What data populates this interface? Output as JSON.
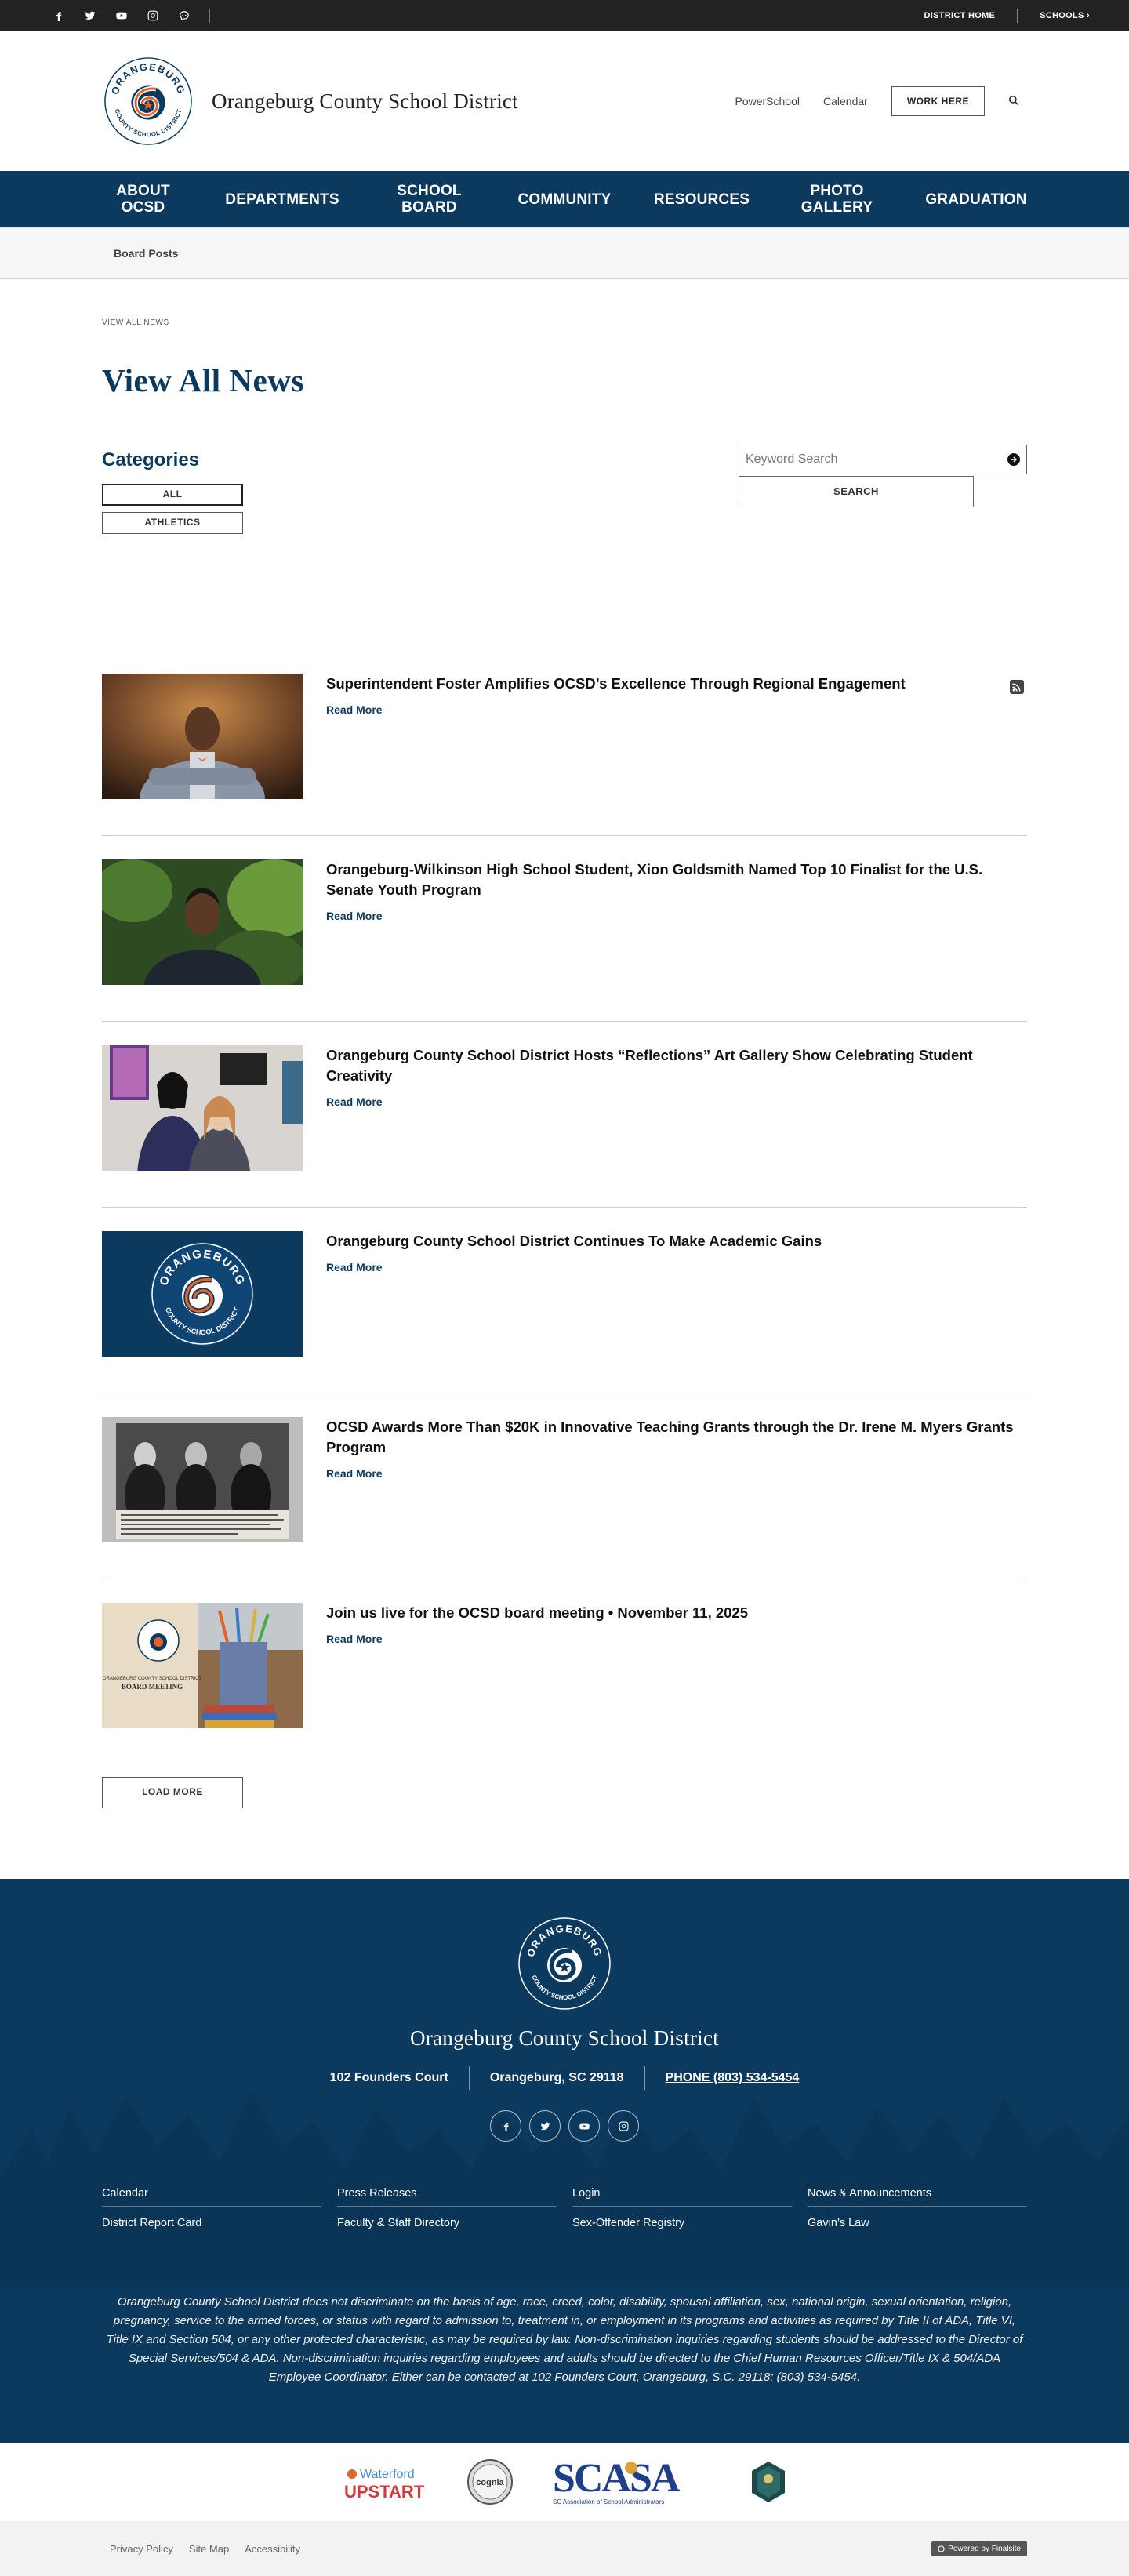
{
  "topbar": {
    "social": [
      "facebook-icon",
      "twitter-icon",
      "youtube-icon",
      "instagram-icon",
      "peachjar-icon"
    ],
    "district_home": "DISTRICT HOME",
    "schools": "SCHOOLS ›"
  },
  "header": {
    "site_name": "Orangeburg County School District",
    "logo_top_text": "ORANGEBURG",
    "logo_bottom_text": "COUNTY SCHOOL DISTRICT",
    "links": [
      "PowerSchool",
      "Calendar"
    ],
    "work_here": "WORK HERE"
  },
  "mainnav": {
    "items": [
      {
        "line1": "ABOUT",
        "line2": "OCSD"
      },
      {
        "line1": "DEPARTMENTS",
        "line2": ""
      },
      {
        "line1": "SCHOOL",
        "line2": "BOARD"
      },
      {
        "line1": "COMMUNITY",
        "line2": ""
      },
      {
        "line1": "RESOURCES",
        "line2": ""
      },
      {
        "line1": "PHOTO",
        "line2": "GALLERY"
      },
      {
        "line1": "GRADUATION",
        "line2": ""
      }
    ]
  },
  "subnav": {
    "label": "Board Posts"
  },
  "page": {
    "breadcrumb": "VIEW ALL NEWS",
    "title": "View All News"
  },
  "categories": {
    "title": "Categories",
    "buttons": [
      "ALL",
      "ATHLETICS"
    ]
  },
  "search": {
    "placeholder": "Keyword Search",
    "button": "SEARCH"
  },
  "news": [
    {
      "title": "Superintendent Foster Amplifies OCSD’s Excellence Through Regional Engagement",
      "read_more": "Read More"
    },
    {
      "title": "Orangeburg-Wilkinson High School Student, Xion Goldsmith Named Top 10 Finalist for the U.S. Senate Youth Program",
      "read_more": "Read More"
    },
    {
      "title": "Orangeburg County School District Hosts “Reflections” Art Gallery Show Celebrating Student Creativity",
      "read_more": "Read More"
    },
    {
      "title": "Orangeburg County School District Continues To Make Academic Gains",
      "read_more": "Read More"
    },
    {
      "title": "OCSD Awards More Than $20K in Innovative Teaching Grants through the Dr. Irene M. Myers Grants Program",
      "read_more": "Read More"
    },
    {
      "title": "Join us live for the OCSD board meeting • November 11, 2025",
      "read_more": "Read More"
    }
  ],
  "thumb_text": {
    "board_meeting_district": "ORANGEBURG COUNTY SCHOOL DISTRICT",
    "board_meeting": "BOARD MEETING"
  },
  "load_more": "LOAD MORE",
  "footer": {
    "site_name": "Orangeburg County School District",
    "address": "102 Founders Court",
    "city": "Orangeburg, SC  29118",
    "phone": "PHONE (803) 534-5454",
    "social": [
      "facebook-icon",
      "twitter-icon",
      "youtube-icon",
      "instagram-icon"
    ],
    "links": [
      "Calendar",
      "Press Releases",
      "Login",
      "News & Announcements",
      "District Report Card",
      "Faculty & Staff Directory",
      "Sex-Offender Registry",
      "Gavin’s Law"
    ],
    "disclaimer": "Orangeburg County School District does not discriminate on the basis of age, race, creed, color, disability, spousal affiliation, sex, national origin, sexual orientation, religion, pregnancy, service to the armed forces, or status with regard to admission to, treatment in, or employment in its programs and activities as required by Title II of ADA, Title VI, Title IX and Section 504, or any other protected characteristic, as may be required by law. Non-discrimination inquiries regarding students should be addressed to the Director of Special Services/504 & ADA. Non-discrimination inquiries regarding employees and adults should be directed to the Chief Human Resources Officer/Title IX & 504/ADA Employee Coordinator. Either can be contacted at 102 Founders Court, Orangeburg, S.C. 29118; (803) 534-5454."
  },
  "partners": {
    "waterford": "Waterford",
    "upstart": "UPSTART",
    "cognia": "cognia",
    "scasa": "SCASA",
    "scasa_sub": "SC Association of School Administrators"
  },
  "bottombar": {
    "links": [
      "Privacy Policy",
      "Site Map",
      "Accessibility"
    ],
    "powered": "Powered by Finalsite"
  },
  "colors": {
    "navy": "#0c3a5e",
    "orange": "#e0632a",
    "topbar": "#222222"
  }
}
